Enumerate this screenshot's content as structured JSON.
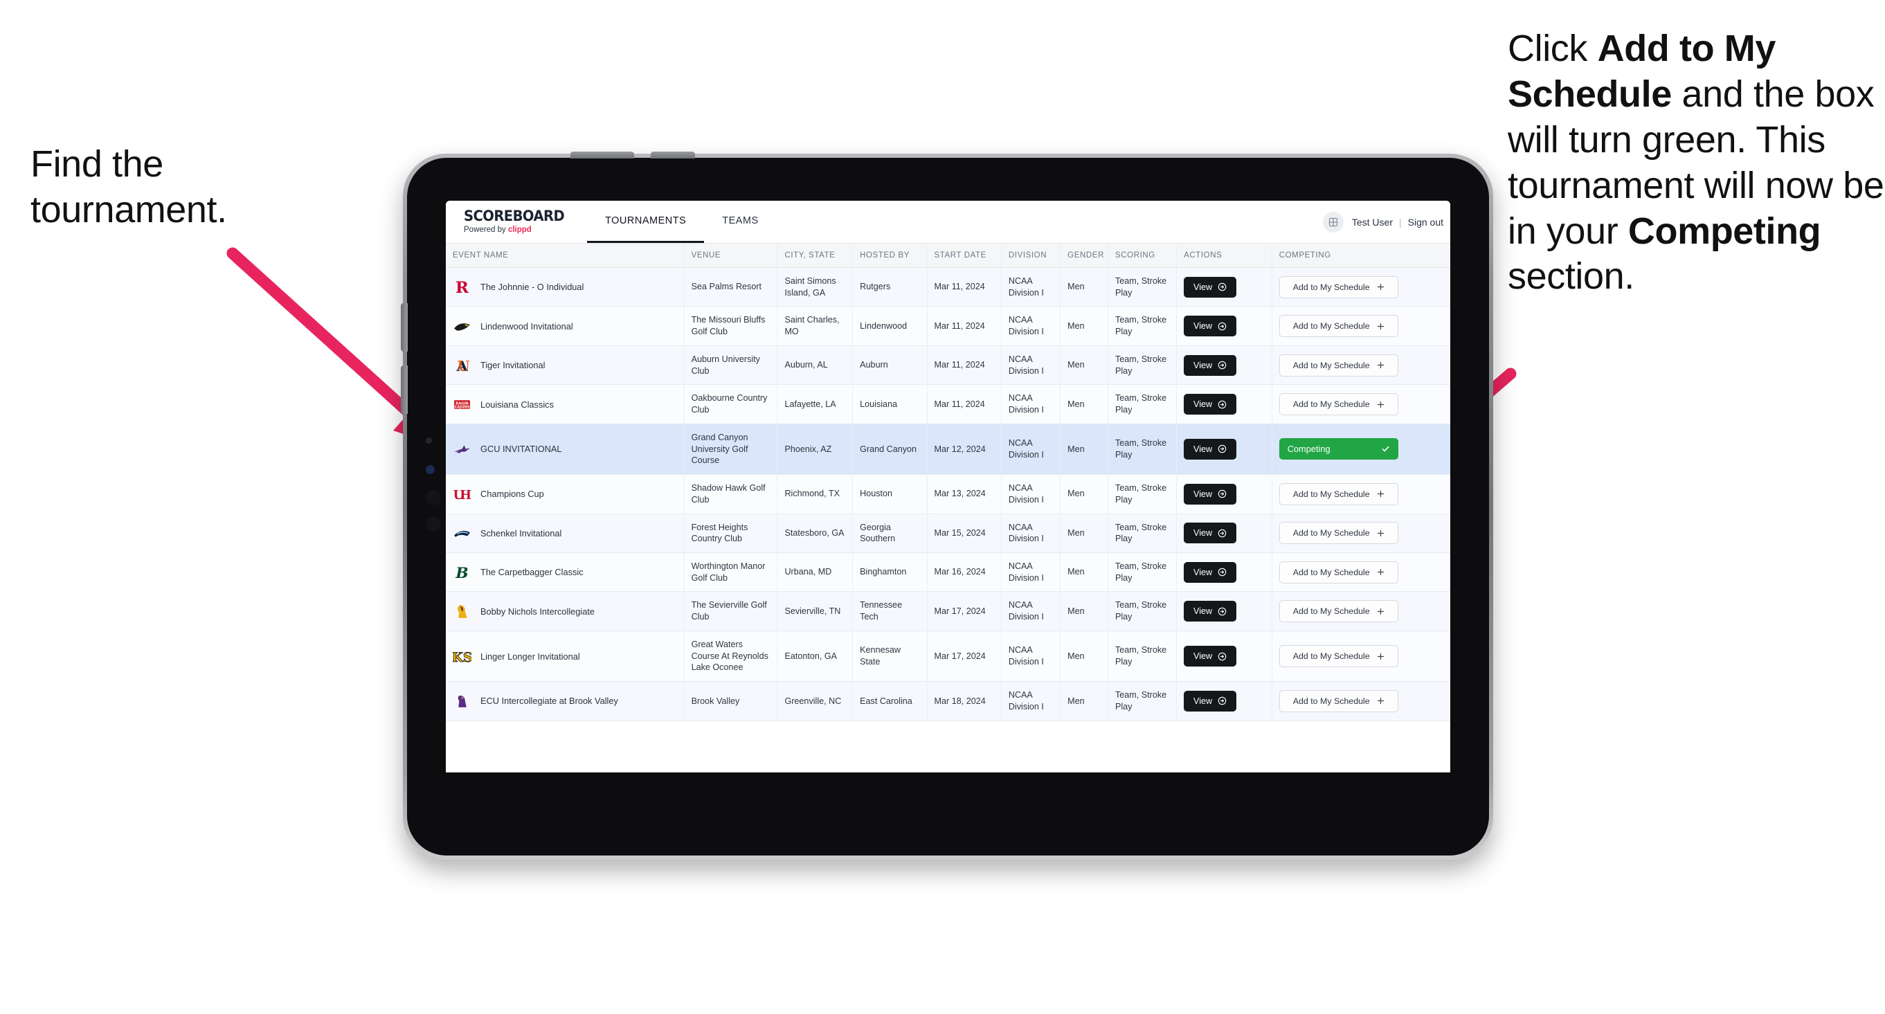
{
  "annotations": {
    "left": {
      "line1": "Find the",
      "line2": "tournament."
    },
    "right": {
      "p1_a": "Click ",
      "p1_b": "Add to My Schedule",
      "p1_c": " and the box will turn green. This tournament will now be in your ",
      "p1_d": "Competing",
      "p1_e": " section."
    },
    "arrow_color": "#e8245e"
  },
  "app": {
    "brand": {
      "title": "SCOREBOARD",
      "powered_prefix": "Powered by ",
      "powered_brand": "clippd"
    },
    "nav": [
      {
        "label": "TOURNAMENTS",
        "active": true
      },
      {
        "label": "TEAMS",
        "active": false
      }
    ],
    "account": {
      "user": "Test User",
      "separator": "|",
      "sign_out": "Sign out",
      "avatar_icon": "user-avatar-icon"
    },
    "table": {
      "columns": [
        "EVENT NAME",
        "VENUE",
        "CITY, STATE",
        "HOSTED BY",
        "START DATE",
        "DIVISION",
        "GENDER",
        "SCORING",
        "ACTIONS",
        "COMPETING"
      ],
      "view_label": "View",
      "add_label": "Add to My Schedule",
      "competing_label": "Competing",
      "rows": [
        {
          "event": "The Johnnie - O Individual",
          "venue": "Sea Palms Resort",
          "city": "Saint Simons Island, GA",
          "hosted_by": "Rutgers",
          "date": "Mar 11, 2024",
          "division": "NCAA Division I",
          "gender": "Men",
          "scoring": "Team, Stroke Play",
          "competing": false,
          "logo": "rutgers-logo"
        },
        {
          "event": "Lindenwood Invitational",
          "venue": "The Missouri Bluffs Golf Club",
          "city": "Saint Charles, MO",
          "hosted_by": "Lindenwood",
          "date": "Mar 11, 2024",
          "division": "NCAA Division I",
          "gender": "Men",
          "scoring": "Team, Stroke Play",
          "competing": false,
          "logo": "lindenwood-logo"
        },
        {
          "event": "Tiger Invitational",
          "venue": "Auburn University Club",
          "city": "Auburn, AL",
          "hosted_by": "Auburn",
          "date": "Mar 11, 2024",
          "division": "NCAA Division I",
          "gender": "Men",
          "scoring": "Team, Stroke Play",
          "competing": false,
          "logo": "auburn-logo"
        },
        {
          "event": "Louisiana Classics",
          "venue": "Oakbourne Country Club",
          "city": "Lafayette, LA",
          "hosted_by": "Louisiana",
          "date": "Mar 11, 2024",
          "division": "NCAA Division I",
          "gender": "Men",
          "scoring": "Team, Stroke Play",
          "competing": false,
          "logo": "louisiana-logo"
        },
        {
          "event": "GCU INVITATIONAL",
          "venue": "Grand Canyon University Golf Course",
          "city": "Phoenix, AZ",
          "hosted_by": "Grand Canyon",
          "date": "Mar 12, 2024",
          "division": "NCAA Division I",
          "gender": "Men",
          "scoring": "Team, Stroke Play",
          "competing": true,
          "logo": "grand-canyon-logo"
        },
        {
          "event": "Champions Cup",
          "venue": "Shadow Hawk Golf Club",
          "city": "Richmond, TX",
          "hosted_by": "Houston",
          "date": "Mar 13, 2024",
          "division": "NCAA Division I",
          "gender": "Men",
          "scoring": "Team, Stroke Play",
          "competing": false,
          "logo": "houston-logo"
        },
        {
          "event": "Schenkel Invitational",
          "venue": "Forest Heights Country Club",
          "city": "Statesboro, GA",
          "hosted_by": "Georgia Southern",
          "date": "Mar 15, 2024",
          "division": "NCAA Division I",
          "gender": "Men",
          "scoring": "Team, Stroke Play",
          "competing": false,
          "logo": "georgia-southern-logo"
        },
        {
          "event": "The Carpetbagger Classic",
          "venue": "Worthington Manor Golf Club",
          "city": "Urbana, MD",
          "hosted_by": "Binghamton",
          "date": "Mar 16, 2024",
          "division": "NCAA Division I",
          "gender": "Men",
          "scoring": "Team, Stroke Play",
          "competing": false,
          "logo": "binghamton-logo"
        },
        {
          "event": "Bobby Nichols Intercollegiate",
          "venue": "The Sevierville Golf Club",
          "city": "Sevierville, TN",
          "hosted_by": "Tennessee Tech",
          "date": "Mar 17, 2024",
          "division": "NCAA Division I",
          "gender": "Men",
          "scoring": "Team, Stroke Play",
          "competing": false,
          "logo": "tennessee-tech-logo"
        },
        {
          "event": "Linger Longer Invitational",
          "venue": "Great Waters Course At Reynolds Lake Oconee",
          "city": "Eatonton, GA",
          "hosted_by": "Kennesaw State",
          "date": "Mar 17, 2024",
          "division": "NCAA Division I",
          "gender": "Men",
          "scoring": "Team, Stroke Play",
          "competing": false,
          "logo": "kennesaw-state-logo"
        },
        {
          "event": "ECU Intercollegiate at Brook Valley",
          "venue": "Brook Valley",
          "city": "Greenville, NC",
          "hosted_by": "East Carolina",
          "date": "Mar 18, 2024",
          "division": "NCAA Division I",
          "gender": "Men",
          "scoring": "Team, Stroke Play",
          "competing": false,
          "logo": "east-carolina-logo"
        }
      ]
    }
  },
  "colors": {
    "competing_green": "#22a545",
    "accent_pink": "#e8245e",
    "selected_row": "#dbe6fa",
    "dark_button": "#15171b"
  }
}
